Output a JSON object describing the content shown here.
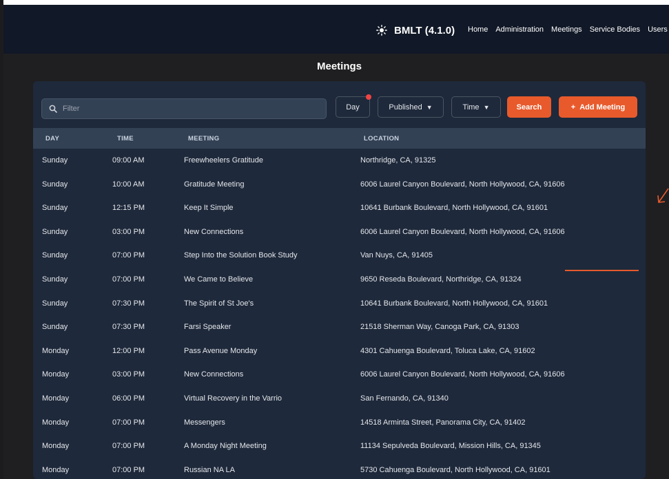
{
  "header": {
    "brand": "BMLT (4.1.0)",
    "brand_icon": "sun-icon",
    "nav": [
      "Home",
      "Administration",
      "Meetings",
      "Service Bodies",
      "Users"
    ]
  },
  "page": {
    "title": "Meetings"
  },
  "toolbar": {
    "filter_placeholder": "Filter",
    "day_label": "Day",
    "published_label": "Published",
    "time_label": "Time",
    "search_label": "Search",
    "add_label": "Add Meeting"
  },
  "table": {
    "columns": [
      "DAY",
      "TIME",
      "MEETING",
      "LOCATION"
    ],
    "rows": [
      {
        "day": "Sunday",
        "time": "09:00 AM",
        "meeting": "Freewheelers Gratitude",
        "location": "Northridge, CA, 91325"
      },
      {
        "day": "Sunday",
        "time": "10:00 AM",
        "meeting": "Gratitude Meeting",
        "location": "6006 Laurel Canyon Boulevard, North Hollywood, CA, 91606"
      },
      {
        "day": "Sunday",
        "time": "12:15 PM",
        "meeting": "Keep It Simple",
        "location": "10641 Burbank Boulevard, North Hollywood, CA, 91601"
      },
      {
        "day": "Sunday",
        "time": "03:00 PM",
        "meeting": "New Connections",
        "location": "6006 Laurel Canyon Boulevard, North Hollywood, CA, 91606"
      },
      {
        "day": "Sunday",
        "time": "07:00 PM",
        "meeting": "Step Into the Solution Book Study",
        "location": "Van Nuys, CA, 91405"
      },
      {
        "day": "Sunday",
        "time": "07:00 PM",
        "meeting": "We Came to Believe",
        "location": "9650 Reseda Boulevard, Northridge, CA, 91324"
      },
      {
        "day": "Sunday",
        "time": "07:30 PM",
        "meeting": "The Spirit of St Joe's",
        "location": "10641 Burbank Boulevard, North Hollywood, CA, 91601"
      },
      {
        "day": "Sunday",
        "time": "07:30 PM",
        "meeting": "Farsi Speaker",
        "location": "21518 Sherman Way, Canoga Park, CA, 91303"
      },
      {
        "day": "Monday",
        "time": "12:00 PM",
        "meeting": "Pass Avenue Monday",
        "location": "4301 Cahuenga Boulevard, Toluca Lake, CA, 91602"
      },
      {
        "day": "Monday",
        "time": "03:00 PM",
        "meeting": "New Connections",
        "location": "6006 Laurel Canyon Boulevard, North Hollywood, CA, 91606"
      },
      {
        "day": "Monday",
        "time": "06:00 PM",
        "meeting": "Virtual Recovery in the Varrio",
        "location": "San Fernando, CA, 91340"
      },
      {
        "day": "Monday",
        "time": "07:00 PM",
        "meeting": "Messengers",
        "location": "14518 Arminta Street, Panorama City, CA, 91402"
      },
      {
        "day": "Monday",
        "time": "07:00 PM",
        "meeting": "A Monday Night Meeting",
        "location": "11134 Sepulveda Boulevard, Mission Hills, CA, 91345"
      },
      {
        "day": "Monday",
        "time": "07:00 PM",
        "meeting": "Russian NA LA",
        "location": "5730 Cahuenga Boulevard, North Hollywood, CA, 91601"
      }
    ]
  },
  "colors": {
    "accent": "#e85a2c",
    "navbar": "#111827",
    "panel": "#1e293b",
    "table_header": "#334155",
    "badge_dot": "#ef4444"
  }
}
